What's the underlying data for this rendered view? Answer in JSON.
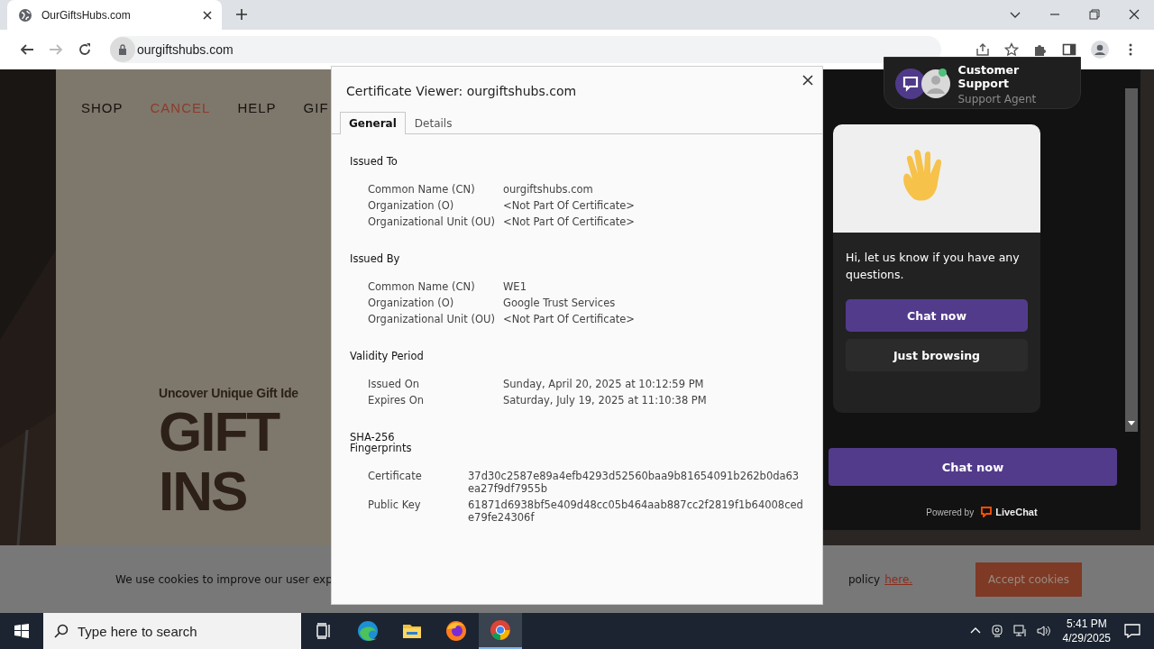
{
  "browser": {
    "tabs": [
      {
        "title": "OurGiftsHubs.com",
        "selected": true
      }
    ],
    "address": "ourgiftshubs.com"
  },
  "website": {
    "nav": [
      {
        "label": "SHOP",
        "selected": false
      },
      {
        "label": "CANCEL",
        "selected": true
      },
      {
        "label": "HELP",
        "selected": false
      },
      {
        "label": "GIF",
        "selected": false
      }
    ],
    "tagline": "Uncover Unique Gift Ide",
    "headline": [
      "GIFT",
      "INS"
    ],
    "cookie_bar": {
      "text": "We use cookies to improve our user exp",
      "text_end": "policy",
      "link": "here.",
      "button": "Accept cookies"
    }
  },
  "dialog": {
    "title": "Certificate Viewer: ourgiftshubs.com",
    "tabs": [
      {
        "label": "General",
        "selected": true
      },
      {
        "label": "Details",
        "selected": false
      }
    ],
    "sections": [
      {
        "heading": "Issued To",
        "kind": "fields",
        "fields": [
          {
            "label": "Common Name (CN)",
            "value": "ourgiftshubs.com"
          },
          {
            "label": "Organization (O)",
            "value": "<Not Part Of Certificate>"
          },
          {
            "label": "Organizational Unit (OU)",
            "value": "<Not Part Of Certificate>"
          }
        ]
      },
      {
        "heading": "Issued By",
        "kind": "fields",
        "fields": [
          {
            "label": "Common Name (CN)",
            "value": "WE1"
          },
          {
            "label": "Organization (O)",
            "value": "Google Trust Services"
          },
          {
            "label": "Organizational Unit (OU)",
            "value": "<Not Part Of Certificate>"
          }
        ]
      },
      {
        "heading": "Validity Period",
        "kind": "fields",
        "fields": [
          {
            "label": "Issued On",
            "value": "Sunday, April 20, 2025 at 10:12:59 PM"
          },
          {
            "label": "Expires On",
            "value": "Saturday, July 19, 2025 at 11:10:38 PM"
          }
        ]
      },
      {
        "heading": "SHA-256 Fingerprints",
        "kind": "hashes",
        "fields": [
          {
            "label": "Certificate",
            "value": "37d30c2587e89a4efb4293d52560baa9b81654091b262b0da63ea27f9df7955b"
          },
          {
            "label": "Public Key",
            "value": "61871d6938bf5e409d48cc05b464aab887cc2f2819f1b64008cede79fe24306f"
          }
        ]
      }
    ]
  },
  "chat": {
    "agent_name": "Customer Support",
    "agent_role": "Support Agent",
    "online": true,
    "message": "Hi, let us know if you have any questions.",
    "buttons": [
      {
        "label": "Chat now",
        "kind": "primary"
      },
      {
        "label": "Just browsing",
        "kind": "secondary"
      }
    ],
    "footer_button": "Chat now",
    "powered_by": "Powered by",
    "brand": "LiveChat"
  },
  "taskbar": {
    "search_placeholder": "Type here to search",
    "apps": [
      {
        "kind": "taskview",
        "selected": false
      },
      {
        "kind": "edge",
        "selected": false
      },
      {
        "kind": "explorer",
        "selected": false
      },
      {
        "kind": "firefox",
        "selected": false
      },
      {
        "kind": "chrome",
        "selected": true
      }
    ],
    "time": "5:41 PM",
    "date": "4/29/2025"
  }
}
